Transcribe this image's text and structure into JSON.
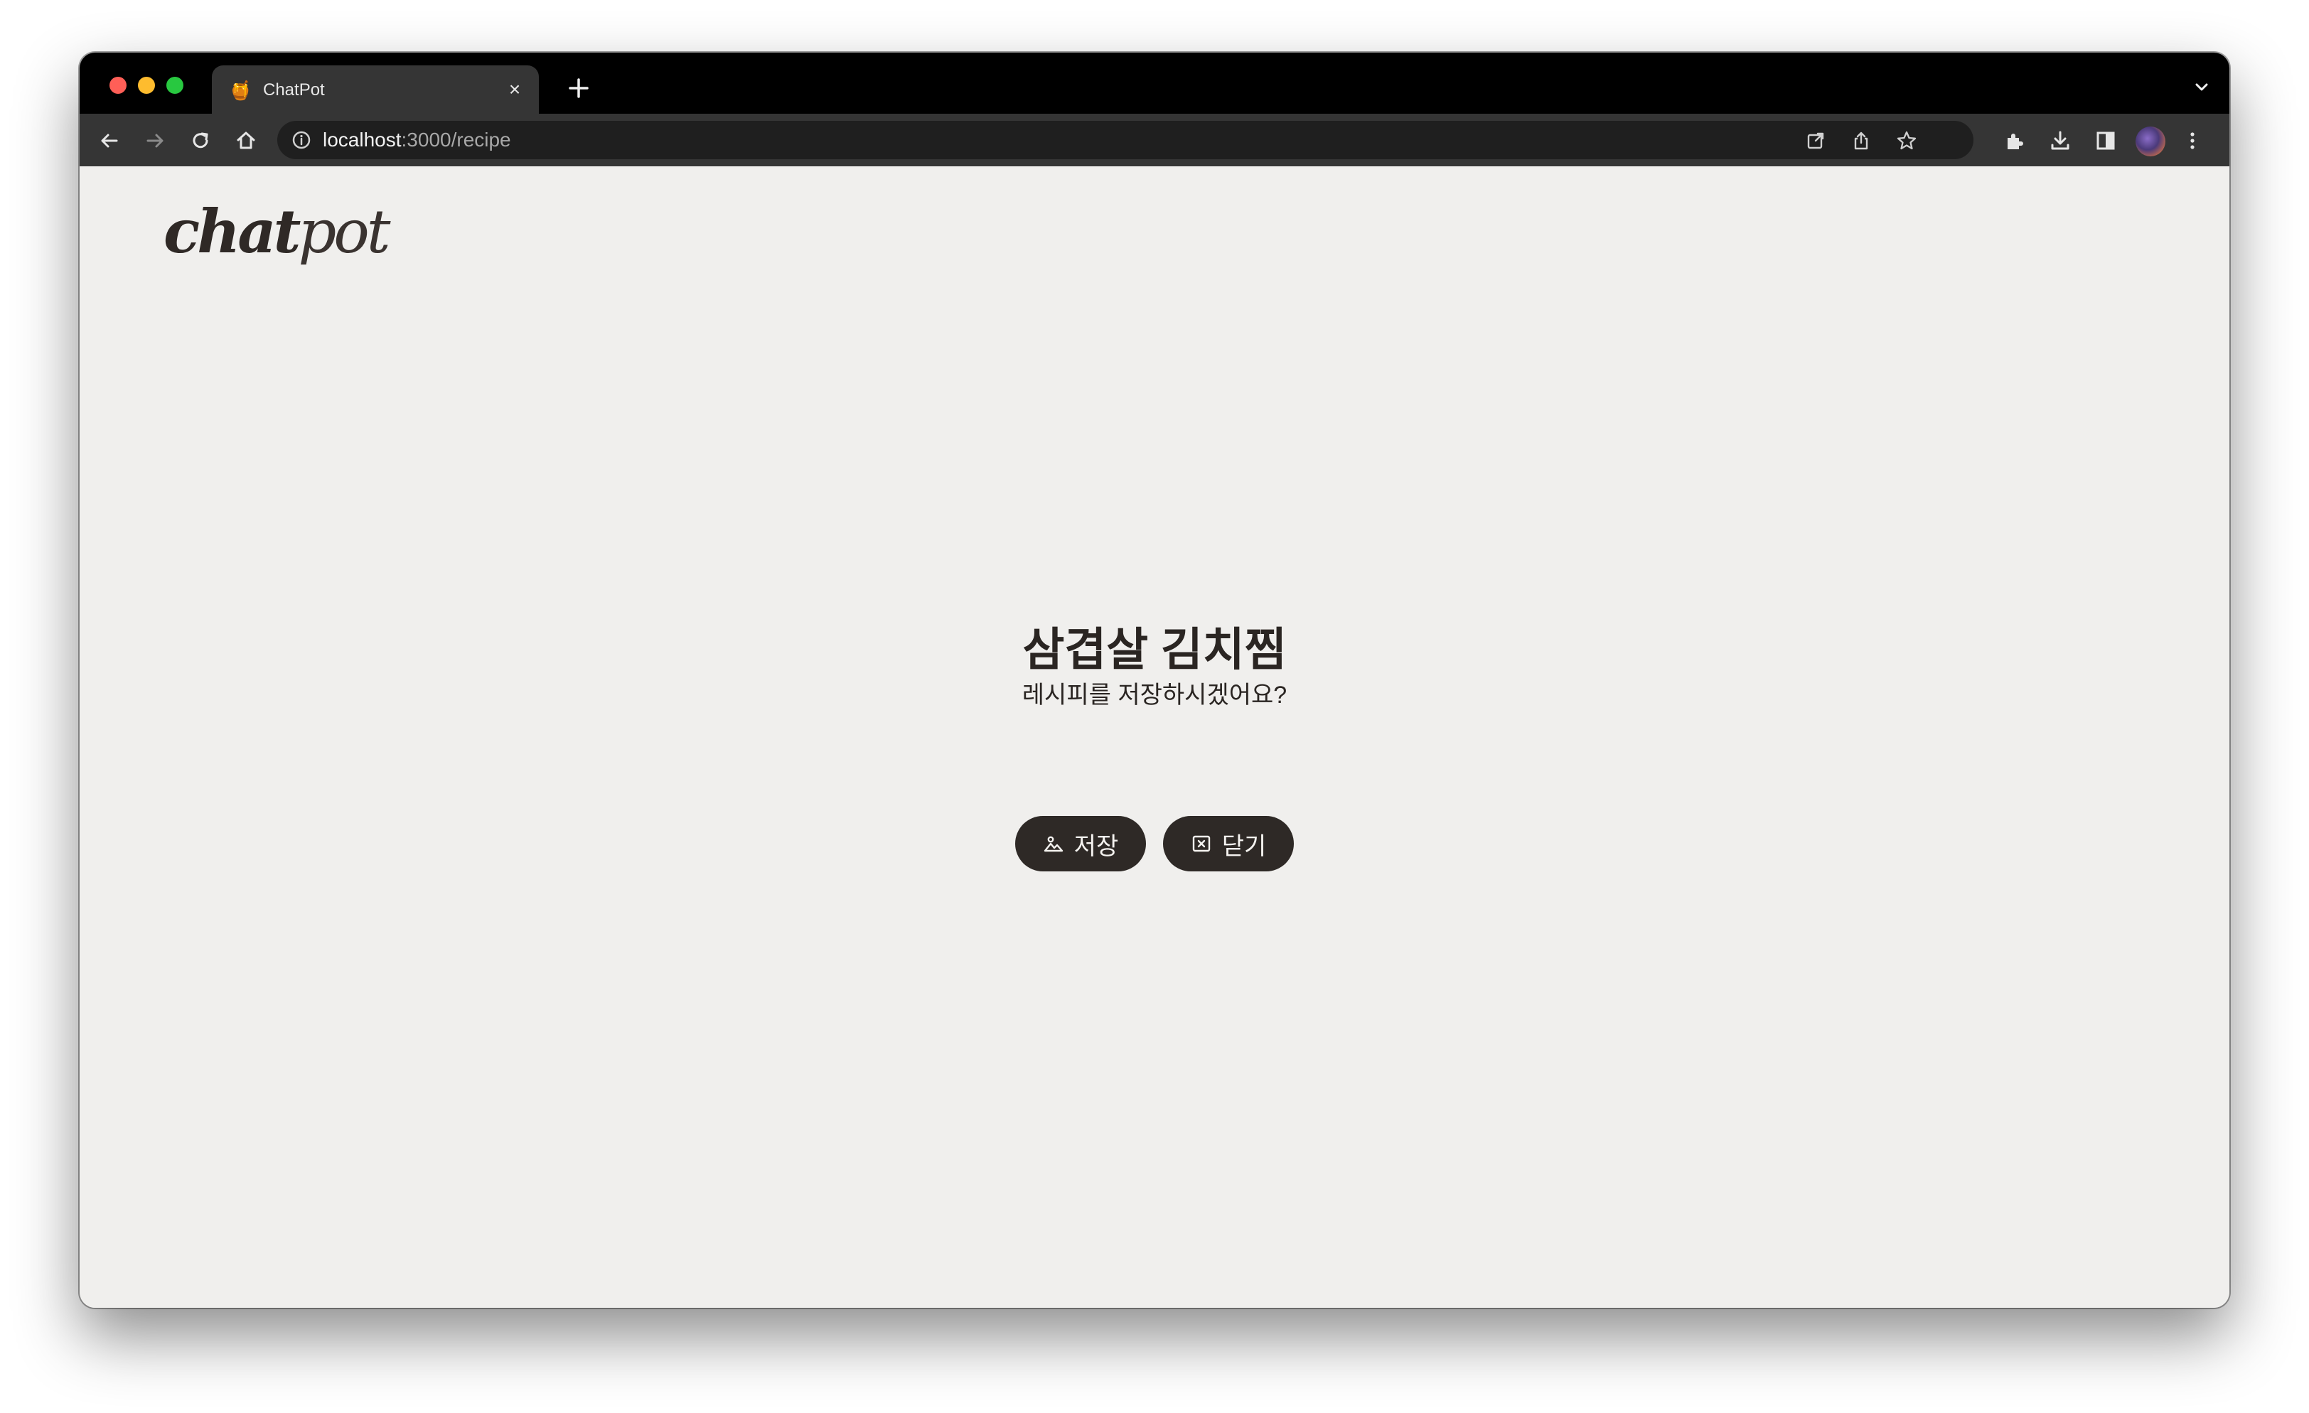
{
  "browser": {
    "tab": {
      "title": "ChatPot",
      "favicon": "honey-pot-icon",
      "favicon_glyph": "🍯",
      "close_glyph": "×"
    },
    "url": {
      "host": "localhost",
      "path": ":3000/recipe"
    },
    "toolbar_icons": [
      "back-icon",
      "forward-icon",
      "reload-icon",
      "home-icon",
      "info-icon",
      "open-external-icon",
      "share-icon",
      "star-icon",
      "extensions-icon",
      "download-icon",
      "side-panel-icon",
      "avatar",
      "more-icon"
    ]
  },
  "page": {
    "logo": {
      "part1": "chat",
      "part2": "pot"
    },
    "recipe_title": "삼겹살 김치찜",
    "prompt": "레시피를 저장하시겠어요?",
    "buttons": {
      "save": {
        "label": "저장",
        "icon": "image-icon"
      },
      "close": {
        "label": "닫기",
        "icon": "close-box-icon"
      }
    }
  },
  "colors": {
    "page_bg": "#f0efed",
    "button_bg": "#2e2926",
    "text": "#2a2522"
  }
}
